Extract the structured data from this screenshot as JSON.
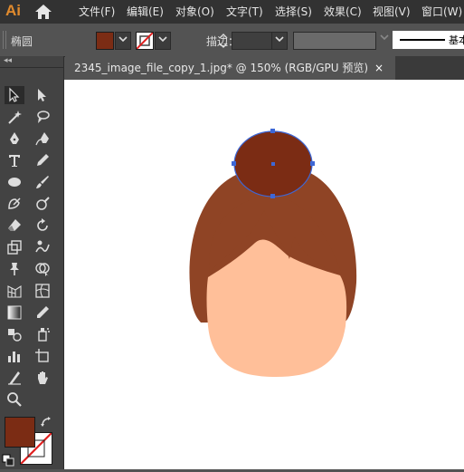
{
  "app": {
    "logo": "Ai"
  },
  "menu": [
    "文件(F)",
    "编辑(E)",
    "对象(O)",
    "文字(T)",
    "选择(S)",
    "效果(C)",
    "视图(V)",
    "窗口(W)"
  ],
  "control": {
    "tool_name": "椭圆",
    "fill_color": "#7b2c14",
    "stroke_label": "描边：",
    "stroke_profile_label": "基本"
  },
  "document": {
    "tab_title": "2345_image_file_copy_1.jpg* @ 150% (RGB/GPU 预览)",
    "close_glyph": "×"
  },
  "toolbar": {
    "collapse_glyph": "◂◂",
    "tools": [
      "selection-tool",
      "direct-selection-tool",
      "magic-wand-tool",
      "lasso-tool",
      "pen-tool",
      "curvature-tool",
      "type-tool",
      "pencil-tool",
      "ellipse-tool",
      "paintbrush-tool",
      "shaper-tool",
      "blob-brush-tool",
      "eraser-tool",
      "rotate-tool",
      "scale-tool",
      "warp-tool",
      "puppet-warp-tool",
      "shape-builder-tool",
      "perspective-grid-tool",
      "mesh-tool",
      "gradient-tool",
      "eyedropper-tool",
      "blend-tool",
      "symbol-sprayer-tool",
      "column-graph-tool",
      "artboard-tool",
      "slice-tool",
      "hand-tool",
      "zoom-tool"
    ]
  },
  "colors": {
    "hair": "#8f4425",
    "bun": "#7b2c14",
    "skin": "#ffbf99",
    "selection": "#3d67d6"
  }
}
